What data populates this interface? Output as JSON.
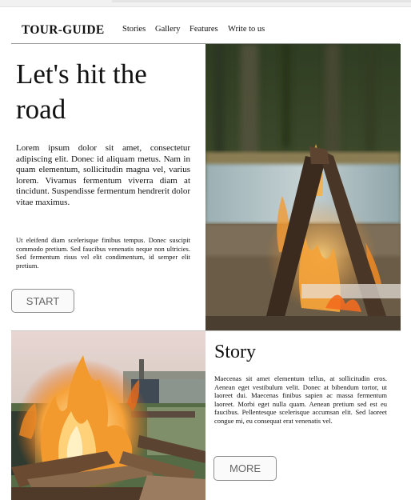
{
  "header": {
    "brand": "TOUR-GUIDE",
    "nav": [
      "Stories",
      "Gallery",
      "Features",
      "Write to us"
    ]
  },
  "hero": {
    "title": "Let's hit the road",
    "paragraph1": "Lorem ipsum dolor sit amet, consectetur adipiscing elit. Donec id aliquam metus. Nam in quam elementum, sollicitudin magna vel, varius lorem. Vivamus fermentum viverra diam at tincidunt. Suspendisse fermentum hendrerit dolor vitae maximus.",
    "paragraph2": "Ut eleifend diam scelerisque finibus tempus. Donec suscipit commodo pretium. Sed faucibus venenatis neque non ultricies. Sed fermentum risus vel elit condimentum, id semper elit pretium.",
    "button": "START"
  },
  "story": {
    "title": "Story",
    "paragraph": "Maecenas sit amet elementum tellus, at sollicitudin eros. Aenean eget vestibulum velit. Donec at bibendum tortor, ut laoreet dui. Maecenas finibus sapien ac massa fermentum laoreet. Morbi eget nulla quam. Aenean pretium sed est eu faucibus. Pellentesque scelerisque accumsan elit. Sed laoreet congue mi, eu consequat erat venenatis vel.",
    "button": "MORE"
  },
  "colors": {
    "button_text": "#666666",
    "button_border": "#8f8f8f",
    "divider": "#9a9a9a",
    "fire": "#f08a24"
  }
}
